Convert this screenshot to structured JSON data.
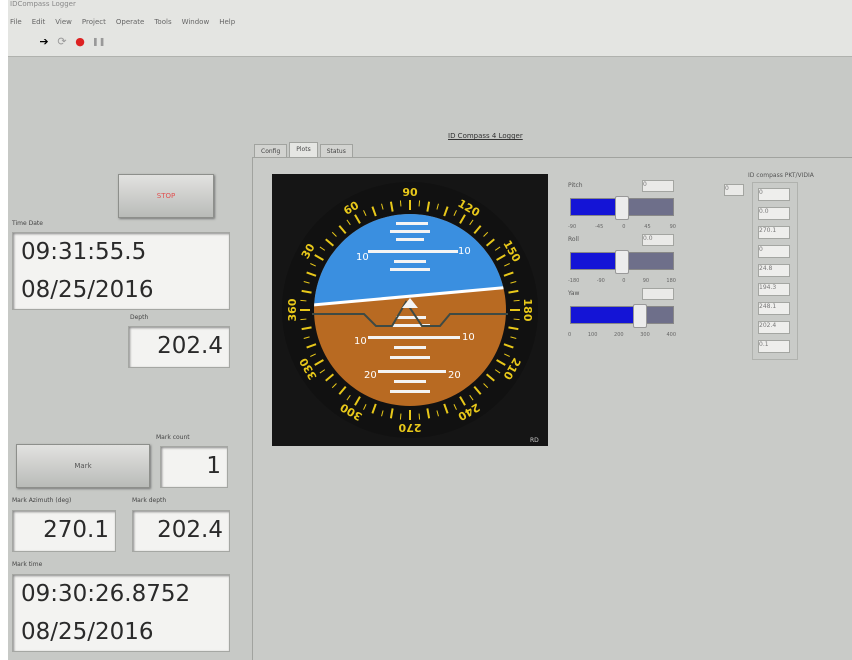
{
  "window": {
    "title": "IDCompass Logger"
  },
  "menu": {
    "items": [
      "File",
      "Edit",
      "View",
      "Project",
      "Operate",
      "Tools",
      "Window",
      "Help"
    ]
  },
  "toolbar": {
    "icons": [
      "run-arrow-icon",
      "run-continuous-icon",
      "abort-icon",
      "pause-icon"
    ]
  },
  "vi_title": "ID Compass 4 Logger",
  "left_panel": {
    "stop_label": "STOP",
    "time_date_label": "Time Date",
    "time": "09:31:55.5",
    "date": "08/25/2016",
    "depth_label": "Depth",
    "depth": "202.4",
    "mark_label": "Mark",
    "mark_count_label": "Mark count",
    "mark_count": "1",
    "mark_azimuth_label": "Mark Azimuth (deg)",
    "mark_azimuth": "270.1",
    "mark_depth_label": "Mark depth",
    "mark_depth": "202.4",
    "mark_time_label": "Mark time",
    "mark_time": "09:30:26.8752",
    "mark_date": "08/25/2016"
  },
  "tabs": [
    {
      "label": "Config"
    },
    {
      "label": "Plots"
    },
    {
      "label": "Status"
    }
  ],
  "attitude": {
    "heading_ticks": [
      "30",
      "60",
      "90",
      "120",
      "150",
      "180",
      "210",
      "240",
      "270",
      "300",
      "330",
      "360"
    ],
    "pitch_marks_sky": [
      "10",
      "10"
    ],
    "pitch_marks_ground": [
      "10",
      "10",
      "20",
      "20"
    ],
    "corner_label": "RD",
    "colors": {
      "sky": "#3a8fe0",
      "ground": "#b86a22",
      "bezel": "#111111",
      "tick": "#e8c81a"
    }
  },
  "sliders": [
    {
      "label": "Pitch",
      "value": "0",
      "scale": [
        "-90",
        "-45",
        "0",
        "45",
        "90"
      ],
      "level": 0.5
    },
    {
      "label": "Roll",
      "value": "0.0",
      "scale": [
        "-180",
        "-90",
        "0",
        "90",
        "180"
      ],
      "level": 0.5
    },
    {
      "label": "Yaw",
      "value": "",
      "scale": [
        "0",
        "100",
        "200",
        "300",
        "400"
      ],
      "level": 0.68
    }
  ],
  "array": {
    "label": "ID compass PKT/VIDIA",
    "index": "0",
    "values": [
      "0",
      "0.0",
      "270.1",
      "0",
      "24.8",
      "194.3",
      "248.1",
      "202.4",
      "0.1"
    ]
  }
}
